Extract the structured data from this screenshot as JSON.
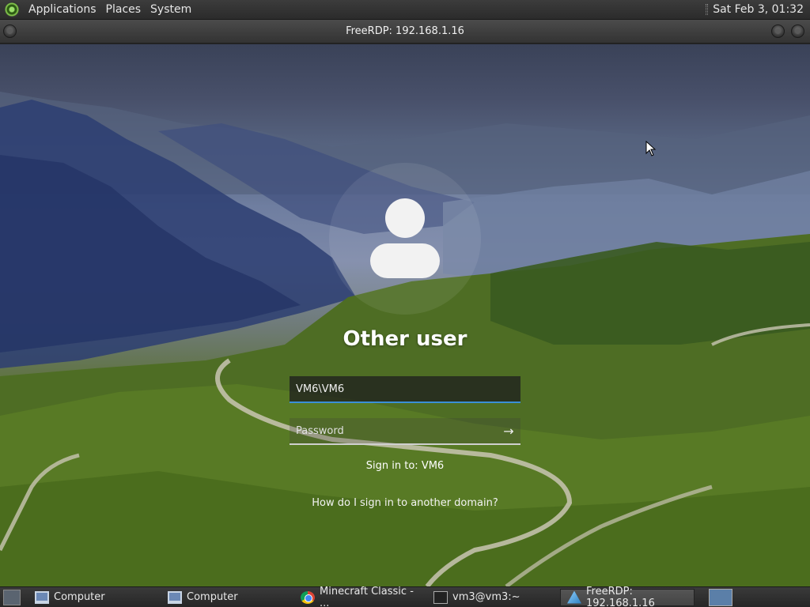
{
  "top_panel": {
    "menus": [
      "Applications",
      "Places",
      "System"
    ],
    "clock": "Sat Feb  3, 01:32"
  },
  "window": {
    "title": "FreeRDP: 192.168.1.16"
  },
  "login": {
    "heading": "Other user",
    "username_value": "VM6\\VM6",
    "password_placeholder": "Password",
    "sign_in_to": "Sign in to: VM6",
    "domain_help_link": "How do I sign in to another domain?",
    "accent_color": "#3a8fd8"
  },
  "taskbar": {
    "tasks": [
      {
        "label": "Computer",
        "icon": "computer-icon"
      },
      {
        "label": "Computer",
        "icon": "computer-icon"
      },
      {
        "label": "Minecraft Classic - ...",
        "icon": "chrome-icon"
      },
      {
        "label": "vm3@vm3:~",
        "icon": "terminal-icon"
      },
      {
        "label": "FreeRDP: 192.168.1.16",
        "icon": "freerdp-icon",
        "active": true
      }
    ]
  }
}
